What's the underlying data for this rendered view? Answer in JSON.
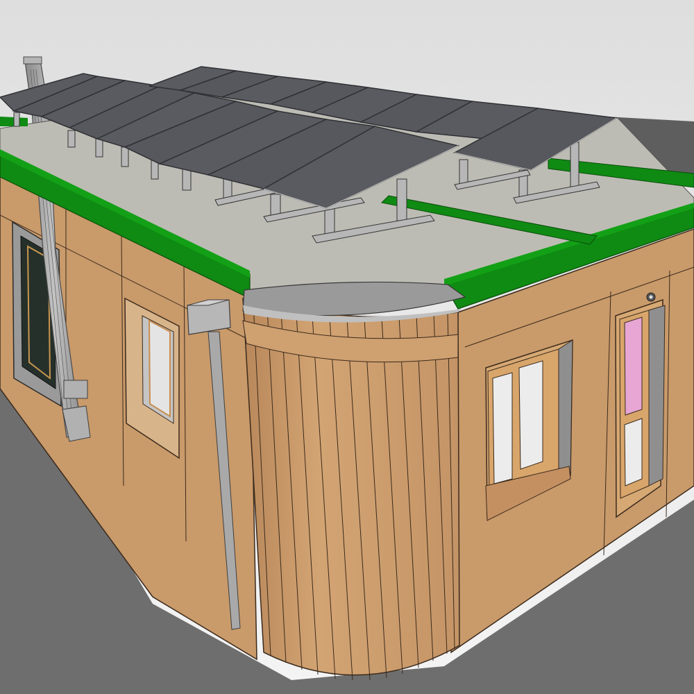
{
  "scene": {
    "subject": "modular-timber-building",
    "view": "3d-perspective-model",
    "colors": {
      "sky_top": "#e3e3e3",
      "sky_bottom": "#f2f2f2",
      "ground": "#6e6e6e",
      "ground_far": "#5a5a5a",
      "roof_surface": "#bdbcb4",
      "parapet_green": "#0f8a12",
      "parapet_green_dark": "#0a6b0d",
      "cladding": "#c99a6a",
      "cladding_shade": "#b8875a",
      "cladding_line": "#3a2a1c",
      "solar_panel": "#5a5b60",
      "solar_frame": "#2f3034",
      "metal_grey": "#a3a3a3",
      "window_frame": "#d8a56b",
      "window_glass": "#e9e9e9",
      "interior_pink": "#e7a6d3",
      "dark_glass": "#26302a"
    }
  }
}
